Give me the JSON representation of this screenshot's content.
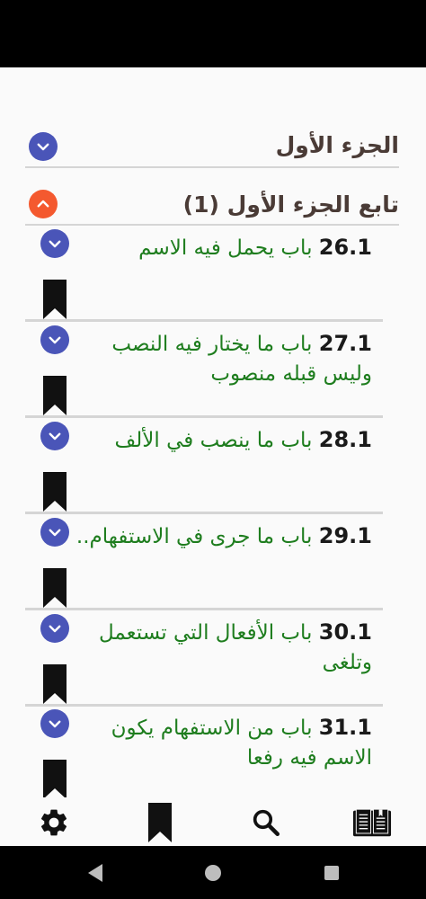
{
  "sections": [
    {
      "title": "الجزء الأول",
      "expanded": false
    },
    {
      "title": "تابع الجزء الأول (1)",
      "expanded": true
    }
  ],
  "items": [
    {
      "number": "26.1",
      "title": "باب يحمل فيه الاسم"
    },
    {
      "number": "27.1",
      "title": "باب ما يختار فيه النصب وليس قبله منصوب"
    },
    {
      "number": "28.1",
      "title": "باب ما ينصب في الألف"
    },
    {
      "number": "29.1",
      "title": "باب ما جرى في الاستفهام.."
    },
    {
      "number": "30.1",
      "title": "باب الأفعال التي تستعمل وتلغى"
    },
    {
      "number": "31.1",
      "title": "باب من الاستفهام يكون الاسم فيه رفعا"
    }
  ],
  "bottom_nav": [
    {
      "icon": "settings-icon"
    },
    {
      "icon": "bookmark-icon"
    },
    {
      "icon": "search-icon"
    },
    {
      "icon": "book-icon"
    }
  ],
  "system_nav": [
    {
      "icon": "back-icon"
    },
    {
      "icon": "home-icon"
    },
    {
      "icon": "recents-icon"
    }
  ],
  "colors": {
    "accent_blue": "#4a55b8",
    "accent_orange": "#f4592f",
    "item_text": "#1e7d1e",
    "header_text": "#4a3b36"
  }
}
